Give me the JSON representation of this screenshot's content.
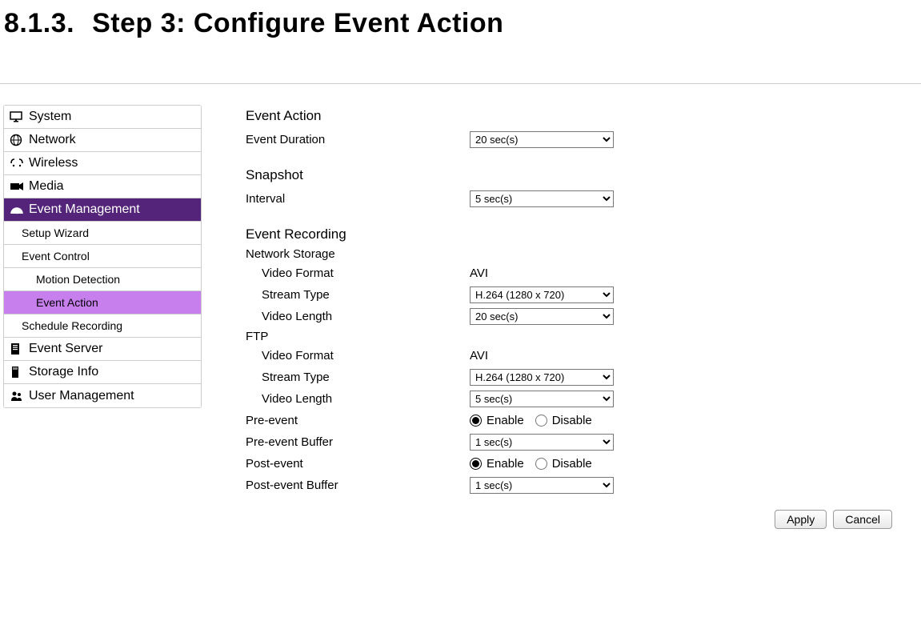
{
  "heading": {
    "number": "8.1.3.",
    "title": "Step 3: Configure Event Action"
  },
  "sidebar": {
    "items": [
      {
        "label": "System"
      },
      {
        "label": "Network"
      },
      {
        "label": "Wireless"
      },
      {
        "label": "Media"
      },
      {
        "label": "Event Management"
      },
      {
        "label": "Setup Wizard"
      },
      {
        "label": "Event Control"
      },
      {
        "label": "Motion Detection"
      },
      {
        "label": "Event Action"
      },
      {
        "label": "Schedule Recording"
      },
      {
        "label": "Event Server"
      },
      {
        "label": "Storage Info"
      },
      {
        "label": "User Management"
      }
    ]
  },
  "form": {
    "section_event_action": "Event Action",
    "event_duration_label": "Event Duration",
    "event_duration_value": "20 sec(s)",
    "section_snapshot": "Snapshot",
    "interval_label": "Interval",
    "interval_value": "5 sec(s)",
    "section_event_recording": "Event Recording",
    "ns_heading": "Network Storage",
    "ns_video_format_label": "Video Format",
    "ns_video_format_value": "AVI",
    "ns_stream_type_label": "Stream Type",
    "ns_stream_type_value": "H.264 (1280 x 720)",
    "ns_video_length_label": "Video Length",
    "ns_video_length_value": "20 sec(s)",
    "ftp_heading": "FTP",
    "ftp_video_format_label": "Video Format",
    "ftp_video_format_value": "AVI",
    "ftp_stream_type_label": "Stream Type",
    "ftp_stream_type_value": "H.264 (1280 x 720)",
    "ftp_video_length_label": "Video Length",
    "ftp_video_length_value": "5 sec(s)",
    "pre_event_label": "Pre-event",
    "pre_event_enable": "Enable",
    "pre_event_disable": "Disable",
    "pre_event_buffer_label": "Pre-event Buffer",
    "pre_event_buffer_value": "1 sec(s)",
    "post_event_label": "Post-event",
    "post_event_enable": "Enable",
    "post_event_disable": "Disable",
    "post_event_buffer_label": "Post-event Buffer",
    "post_event_buffer_value": "1 sec(s)"
  },
  "buttons": {
    "apply": "Apply",
    "cancel": "Cancel"
  }
}
